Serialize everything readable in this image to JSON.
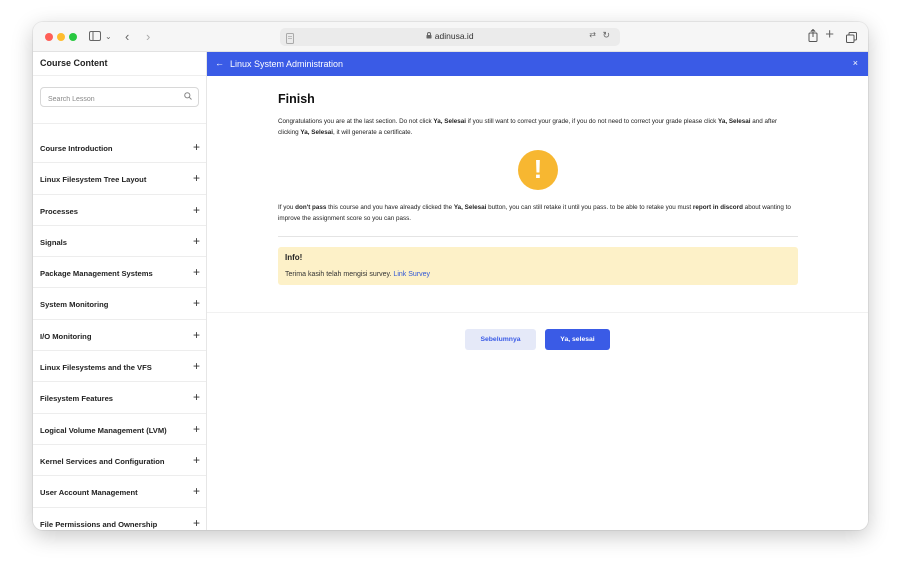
{
  "browser": {
    "url": "adinusa.id"
  },
  "sidebar": {
    "header": "Course Content",
    "search_placeholder": "Search Lesson",
    "sections": [
      {
        "label": "Course Introduction"
      },
      {
        "label": "Linux Filesystem Tree Layout"
      },
      {
        "label": "Processes"
      },
      {
        "label": "Signals"
      },
      {
        "label": "Package Management Systems"
      },
      {
        "label": "System Monitoring"
      },
      {
        "label": "I/O Monitoring"
      },
      {
        "label": "Linux Filesystems and the VFS"
      },
      {
        "label": "Filesystem Features"
      },
      {
        "label": "Logical Volume Management (LVM)"
      },
      {
        "label": "Kernel Services and Configuration"
      },
      {
        "label": "User Account Management"
      },
      {
        "label": "File Permissions and Ownership"
      }
    ]
  },
  "main": {
    "course_title": "Linux System Administration",
    "page_title": "Finish",
    "para1": {
      "a": "Congratulations you are at the last section. Do not click ",
      "b": "Ya, Selesai",
      "c": " if you still want to correct your grade, if you do not need to correct your grade please click ",
      "d": "Ya, Selesai",
      "e": " and after clicking ",
      "f": "Ya, Selesai",
      "g": ", it will generate a certificate."
    },
    "warning_glyph": "!",
    "para2": {
      "a": "If you ",
      "b": "don't pass",
      "c": " this course and you have already clicked the ",
      "d": "Ya, Selesai",
      "e": " button, you can still retake it until you pass. to be able to retake you must ",
      "f": "report in discord",
      "g": " about wanting to improve the assignment score so you can pass."
    },
    "info": {
      "title": "Info!",
      "text": "Terima kasih telah mengisi survey. ",
      "link": "Link Survey"
    },
    "buttons": {
      "previous": "Sebelumnya",
      "finish": "Ya, selesai"
    }
  },
  "colors": {
    "accent": "#3a5be6",
    "warning": "#f7b731",
    "info_bg": "#fdf1c8"
  }
}
